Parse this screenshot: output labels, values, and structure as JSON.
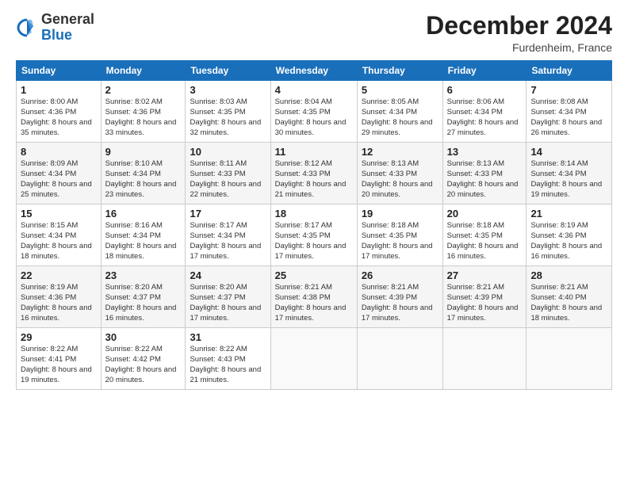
{
  "logo": {
    "general": "General",
    "blue": "Blue"
  },
  "title": "December 2024",
  "location": "Furdenheim, France",
  "days_header": [
    "Sunday",
    "Monday",
    "Tuesday",
    "Wednesday",
    "Thursday",
    "Friday",
    "Saturday"
  ],
  "weeks": [
    [
      {
        "day": "1",
        "sunrise": "8:00 AM",
        "sunset": "4:36 PM",
        "daylight": "8 hours and 35 minutes."
      },
      {
        "day": "2",
        "sunrise": "8:02 AM",
        "sunset": "4:36 PM",
        "daylight": "8 hours and 33 minutes."
      },
      {
        "day": "3",
        "sunrise": "8:03 AM",
        "sunset": "4:35 PM",
        "daylight": "8 hours and 32 minutes."
      },
      {
        "day": "4",
        "sunrise": "8:04 AM",
        "sunset": "4:35 PM",
        "daylight": "8 hours and 30 minutes."
      },
      {
        "day": "5",
        "sunrise": "8:05 AM",
        "sunset": "4:34 PM",
        "daylight": "8 hours and 29 minutes."
      },
      {
        "day": "6",
        "sunrise": "8:06 AM",
        "sunset": "4:34 PM",
        "daylight": "8 hours and 27 minutes."
      },
      {
        "day": "7",
        "sunrise": "8:08 AM",
        "sunset": "4:34 PM",
        "daylight": "8 hours and 26 minutes."
      }
    ],
    [
      {
        "day": "8",
        "sunrise": "8:09 AM",
        "sunset": "4:34 PM",
        "daylight": "8 hours and 25 minutes."
      },
      {
        "day": "9",
        "sunrise": "8:10 AM",
        "sunset": "4:34 PM",
        "daylight": "8 hours and 23 minutes."
      },
      {
        "day": "10",
        "sunrise": "8:11 AM",
        "sunset": "4:33 PM",
        "daylight": "8 hours and 22 minutes."
      },
      {
        "day": "11",
        "sunrise": "8:12 AM",
        "sunset": "4:33 PM",
        "daylight": "8 hours and 21 minutes."
      },
      {
        "day": "12",
        "sunrise": "8:13 AM",
        "sunset": "4:33 PM",
        "daylight": "8 hours and 20 minutes."
      },
      {
        "day": "13",
        "sunrise": "8:13 AM",
        "sunset": "4:33 PM",
        "daylight": "8 hours and 20 minutes."
      },
      {
        "day": "14",
        "sunrise": "8:14 AM",
        "sunset": "4:34 PM",
        "daylight": "8 hours and 19 minutes."
      }
    ],
    [
      {
        "day": "15",
        "sunrise": "8:15 AM",
        "sunset": "4:34 PM",
        "daylight": "8 hours and 18 minutes."
      },
      {
        "day": "16",
        "sunrise": "8:16 AM",
        "sunset": "4:34 PM",
        "daylight": "8 hours and 18 minutes."
      },
      {
        "day": "17",
        "sunrise": "8:17 AM",
        "sunset": "4:34 PM",
        "daylight": "8 hours and 17 minutes."
      },
      {
        "day": "18",
        "sunrise": "8:17 AM",
        "sunset": "4:35 PM",
        "daylight": "8 hours and 17 minutes."
      },
      {
        "day": "19",
        "sunrise": "8:18 AM",
        "sunset": "4:35 PM",
        "daylight": "8 hours and 17 minutes."
      },
      {
        "day": "20",
        "sunrise": "8:18 AM",
        "sunset": "4:35 PM",
        "daylight": "8 hours and 16 minutes."
      },
      {
        "day": "21",
        "sunrise": "8:19 AM",
        "sunset": "4:36 PM",
        "daylight": "8 hours and 16 minutes."
      }
    ],
    [
      {
        "day": "22",
        "sunrise": "8:19 AM",
        "sunset": "4:36 PM",
        "daylight": "8 hours and 16 minutes."
      },
      {
        "day": "23",
        "sunrise": "8:20 AM",
        "sunset": "4:37 PM",
        "daylight": "8 hours and 16 minutes."
      },
      {
        "day": "24",
        "sunrise": "8:20 AM",
        "sunset": "4:37 PM",
        "daylight": "8 hours and 17 minutes."
      },
      {
        "day": "25",
        "sunrise": "8:21 AM",
        "sunset": "4:38 PM",
        "daylight": "8 hours and 17 minutes."
      },
      {
        "day": "26",
        "sunrise": "8:21 AM",
        "sunset": "4:39 PM",
        "daylight": "8 hours and 17 minutes."
      },
      {
        "day": "27",
        "sunrise": "8:21 AM",
        "sunset": "4:39 PM",
        "daylight": "8 hours and 17 minutes."
      },
      {
        "day": "28",
        "sunrise": "8:21 AM",
        "sunset": "4:40 PM",
        "daylight": "8 hours and 18 minutes."
      }
    ],
    [
      {
        "day": "29",
        "sunrise": "8:22 AM",
        "sunset": "4:41 PM",
        "daylight": "8 hours and 19 minutes."
      },
      {
        "day": "30",
        "sunrise": "8:22 AM",
        "sunset": "4:42 PM",
        "daylight": "8 hours and 20 minutes."
      },
      {
        "day": "31",
        "sunrise": "8:22 AM",
        "sunset": "4:43 PM",
        "daylight": "8 hours and 21 minutes."
      },
      null,
      null,
      null,
      null
    ]
  ]
}
